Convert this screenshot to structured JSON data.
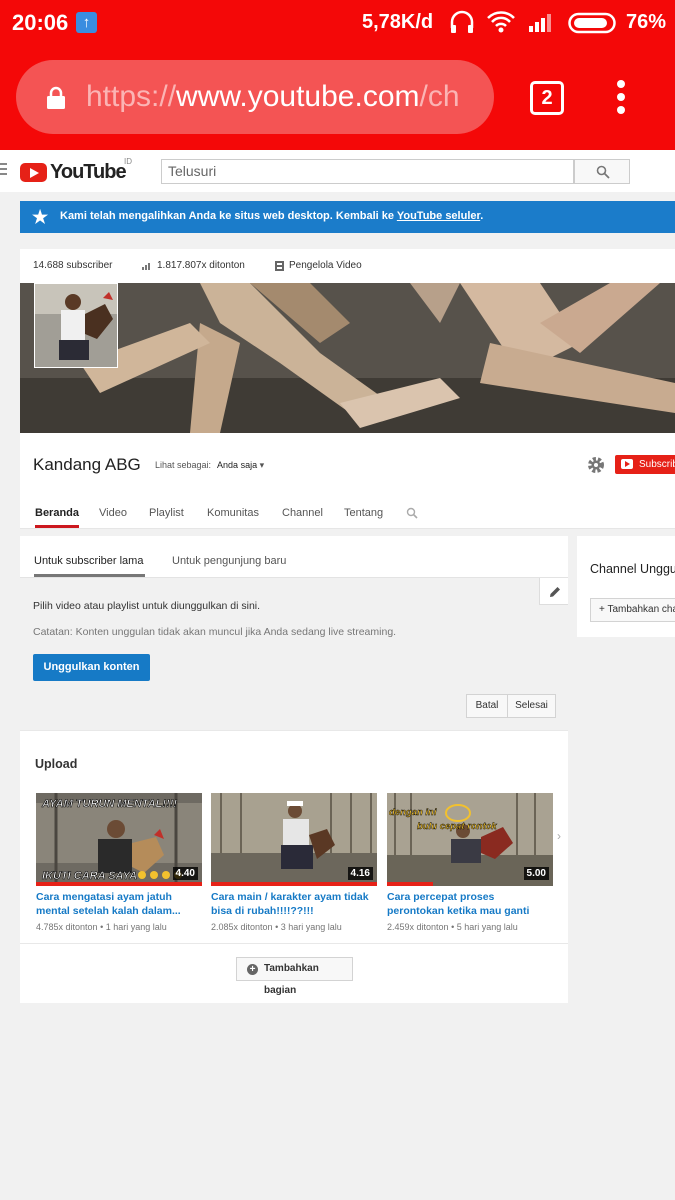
{
  "status_bar": {
    "time": "20:06",
    "net_speed": "5,78K/d",
    "battery": "76%"
  },
  "browser": {
    "url_scheme": "https://",
    "url_host": "www.youtube.com",
    "url_rest": "/ch",
    "tab_count": "2"
  },
  "header": {
    "logo_text": "YouTube",
    "logo_country": "ID",
    "search_placeholder": "Telusuri"
  },
  "banner": {
    "text": "Kami telah mengalihkan Anda ke situs web desktop. Kembali ke",
    "link": "YouTube seluler",
    "suffix": "."
  },
  "channel": {
    "subscribers": "14.688 subscriber",
    "views": "1.817.807x ditonton",
    "video_manager": "Pengelola Video",
    "name": "Kandang ABG",
    "view_as_label": "Lihat sebagai:",
    "view_as_value": "Anda saja",
    "subscribe_label": "Subscribe",
    "tabs": [
      {
        "label": "Beranda"
      },
      {
        "label": "Video"
      },
      {
        "label": "Playlist"
      },
      {
        "label": "Komunitas"
      },
      {
        "label": "Channel"
      },
      {
        "label": "Tentang"
      }
    ]
  },
  "trailer": {
    "subtabs": [
      {
        "label": "Untuk subscriber lama"
      },
      {
        "label": "Untuk pengunjung baru"
      }
    ],
    "line1": "Pilih video atau playlist untuk diunggulkan di sini.",
    "line2": "Catatan: Konten unggulan tidak akan muncul jika Anda sedang live streaming.",
    "feature_button": "Unggulkan konten",
    "cancel_button": "Batal",
    "done_button": "Selesai"
  },
  "uploads": {
    "title": "Upload",
    "videos": [
      {
        "title": "Cara mengatasi ayam jatuh mental setelah kalah dalam...",
        "views": "4.785x ditonton",
        "age": "1 hari yang lalu",
        "duration": "4.40",
        "overlay_top": "AYAM TURUN MENTAL!!!!",
        "overlay_bottom": "IKUTI CARA SAYA",
        "progress": 1.0
      },
      {
        "title": "Cara main / karakter ayam tidak bisa di rubah!!!!??!!!",
        "views": "2.085x ditonton",
        "age": "3 hari yang lalu",
        "duration": "4.16",
        "progress": 1.0
      },
      {
        "title": "Cara percepat proses perontokan ketika mau ganti bulu baru",
        "views": "2.459x ditonton",
        "age": "5 hari yang lalu",
        "duration": "5.00",
        "overlay_top": "dengan ini",
        "overlay_bottom": "bulu cepat rontok",
        "progress": 0.28
      }
    ],
    "add_section": "Tambahkan bagian"
  },
  "sidebar": {
    "title": "Channel Unggulan",
    "add_button": "+ Tambahkan channel"
  },
  "colors": {
    "chrome_red": "#f40808",
    "yt_red": "#e62117",
    "link_blue": "#167ac6",
    "banner_blue": "#1b7cca"
  }
}
